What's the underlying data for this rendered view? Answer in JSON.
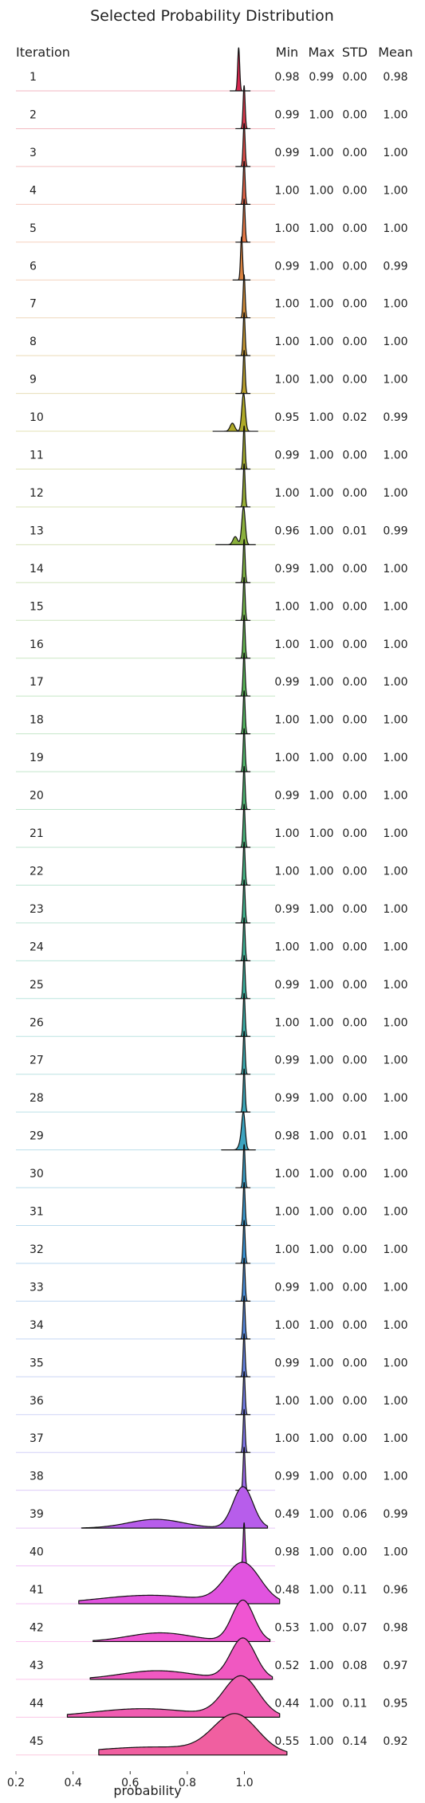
{
  "chart_data": {
    "type": "ridgeline",
    "title": "Selected Probability Distribution",
    "xlabel": "probability",
    "row_header": "Iteration",
    "stat_headers": [
      "Min",
      "Max",
      "STD",
      "Mean"
    ],
    "x_ticks": [
      "0.2",
      "0.4",
      "0.6",
      "0.8",
      "1.0"
    ],
    "xlim": [
      0.2,
      1.18
    ],
    "rows": [
      {
        "iteration": "1",
        "min": "0.98",
        "max": "0.99",
        "std": "0.00",
        "mean": "0.98"
      },
      {
        "iteration": "2",
        "min": "0.99",
        "max": "1.00",
        "std": "0.00",
        "mean": "1.00"
      },
      {
        "iteration": "3",
        "min": "0.99",
        "max": "1.00",
        "std": "0.00",
        "mean": "1.00"
      },
      {
        "iteration": "4",
        "min": "1.00",
        "max": "1.00",
        "std": "0.00",
        "mean": "1.00"
      },
      {
        "iteration": "5",
        "min": "1.00",
        "max": "1.00",
        "std": "0.00",
        "mean": "1.00"
      },
      {
        "iteration": "6",
        "min": "0.99",
        "max": "1.00",
        "std": "0.00",
        "mean": "0.99"
      },
      {
        "iteration": "7",
        "min": "1.00",
        "max": "1.00",
        "std": "0.00",
        "mean": "1.00"
      },
      {
        "iteration": "8",
        "min": "1.00",
        "max": "1.00",
        "std": "0.00",
        "mean": "1.00"
      },
      {
        "iteration": "9",
        "min": "1.00",
        "max": "1.00",
        "std": "0.00",
        "mean": "1.00"
      },
      {
        "iteration": "10",
        "min": "0.95",
        "max": "1.00",
        "std": "0.02",
        "mean": "0.99"
      },
      {
        "iteration": "11",
        "min": "0.99",
        "max": "1.00",
        "std": "0.00",
        "mean": "1.00"
      },
      {
        "iteration": "12",
        "min": "1.00",
        "max": "1.00",
        "std": "0.00",
        "mean": "1.00"
      },
      {
        "iteration": "13",
        "min": "0.96",
        "max": "1.00",
        "std": "0.01",
        "mean": "0.99"
      },
      {
        "iteration": "14",
        "min": "0.99",
        "max": "1.00",
        "std": "0.00",
        "mean": "1.00"
      },
      {
        "iteration": "15",
        "min": "1.00",
        "max": "1.00",
        "std": "0.00",
        "mean": "1.00"
      },
      {
        "iteration": "16",
        "min": "1.00",
        "max": "1.00",
        "std": "0.00",
        "mean": "1.00"
      },
      {
        "iteration": "17",
        "min": "0.99",
        "max": "1.00",
        "std": "0.00",
        "mean": "1.00"
      },
      {
        "iteration": "18",
        "min": "1.00",
        "max": "1.00",
        "std": "0.00",
        "mean": "1.00"
      },
      {
        "iteration": "19",
        "min": "1.00",
        "max": "1.00",
        "std": "0.00",
        "mean": "1.00"
      },
      {
        "iteration": "20",
        "min": "0.99",
        "max": "1.00",
        "std": "0.00",
        "mean": "1.00"
      },
      {
        "iteration": "21",
        "min": "1.00",
        "max": "1.00",
        "std": "0.00",
        "mean": "1.00"
      },
      {
        "iteration": "22",
        "min": "1.00",
        "max": "1.00",
        "std": "0.00",
        "mean": "1.00"
      },
      {
        "iteration": "23",
        "min": "0.99",
        "max": "1.00",
        "std": "0.00",
        "mean": "1.00"
      },
      {
        "iteration": "24",
        "min": "1.00",
        "max": "1.00",
        "std": "0.00",
        "mean": "1.00"
      },
      {
        "iteration": "25",
        "min": "0.99",
        "max": "1.00",
        "std": "0.00",
        "mean": "1.00"
      },
      {
        "iteration": "26",
        "min": "1.00",
        "max": "1.00",
        "std": "0.00",
        "mean": "1.00"
      },
      {
        "iteration": "27",
        "min": "0.99",
        "max": "1.00",
        "std": "0.00",
        "mean": "1.00"
      },
      {
        "iteration": "28",
        "min": "0.99",
        "max": "1.00",
        "std": "0.00",
        "mean": "1.00"
      },
      {
        "iteration": "29",
        "min": "0.98",
        "max": "1.00",
        "std": "0.01",
        "mean": "1.00"
      },
      {
        "iteration": "30",
        "min": "1.00",
        "max": "1.00",
        "std": "0.00",
        "mean": "1.00"
      },
      {
        "iteration": "31",
        "min": "1.00",
        "max": "1.00",
        "std": "0.00",
        "mean": "1.00"
      },
      {
        "iteration": "32",
        "min": "1.00",
        "max": "1.00",
        "std": "0.00",
        "mean": "1.00"
      },
      {
        "iteration": "33",
        "min": "0.99",
        "max": "1.00",
        "std": "0.00",
        "mean": "1.00"
      },
      {
        "iteration": "34",
        "min": "1.00",
        "max": "1.00",
        "std": "0.00",
        "mean": "1.00"
      },
      {
        "iteration": "35",
        "min": "0.99",
        "max": "1.00",
        "std": "0.00",
        "mean": "1.00"
      },
      {
        "iteration": "36",
        "min": "1.00",
        "max": "1.00",
        "std": "0.00",
        "mean": "1.00"
      },
      {
        "iteration": "37",
        "min": "1.00",
        "max": "1.00",
        "std": "0.00",
        "mean": "1.00"
      },
      {
        "iteration": "38",
        "min": "0.99",
        "max": "1.00",
        "std": "0.00",
        "mean": "1.00"
      },
      {
        "iteration": "39",
        "min": "0.49",
        "max": "1.00",
        "std": "0.06",
        "mean": "0.99"
      },
      {
        "iteration": "40",
        "min": "0.98",
        "max": "1.00",
        "std": "0.00",
        "mean": "1.00"
      },
      {
        "iteration": "41",
        "min": "0.48",
        "max": "1.00",
        "std": "0.11",
        "mean": "0.96"
      },
      {
        "iteration": "42",
        "min": "0.53",
        "max": "1.00",
        "std": "0.07",
        "mean": "0.98"
      },
      {
        "iteration": "43",
        "min": "0.52",
        "max": "1.00",
        "std": "0.08",
        "mean": "0.97"
      },
      {
        "iteration": "44",
        "min": "0.44",
        "max": "1.00",
        "std": "0.11",
        "mean": "0.95"
      },
      {
        "iteration": "45",
        "min": "0.55",
        "max": "1.00",
        "std": "0.14",
        "mean": "0.92"
      }
    ],
    "grid": false,
    "legend": "none"
  }
}
